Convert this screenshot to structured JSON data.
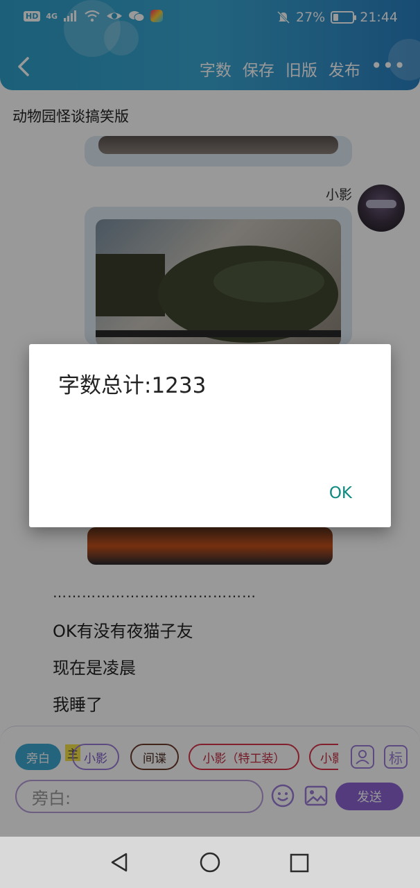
{
  "status_bar": {
    "network": "4G",
    "hd": "HD",
    "battery_percent": "27%",
    "battery_level": 0.27,
    "time": "21:44"
  },
  "header": {
    "actions": [
      "字数",
      "保存",
      "旧版",
      "发布"
    ],
    "more": "•••"
  },
  "document": {
    "title": "动物园怪谈搞笑版"
  },
  "chat": {
    "speaker": "小影",
    "separator": "……………………………………",
    "messages": [
      "OK有没有夜猫子友",
      "现在是凌晨",
      "我睡了"
    ]
  },
  "composer": {
    "roles": [
      "旁白",
      "小影",
      "间谍",
      "小影（特工装）",
      "小影"
    ],
    "main_marker": "主",
    "mark_button": "标",
    "input_placeholder": "旁白:",
    "send_label": "发送"
  },
  "dialog": {
    "message": "字数总计:1233",
    "ok_label": "OK"
  },
  "icons": {
    "back": "chevron-left-icon",
    "emoji": "smile-icon",
    "image": "image-icon",
    "person": "person-icon"
  },
  "colors": {
    "accent": "#3fa7d0",
    "purple": "#8a63d2",
    "dialog_button": "#0d8a80"
  }
}
